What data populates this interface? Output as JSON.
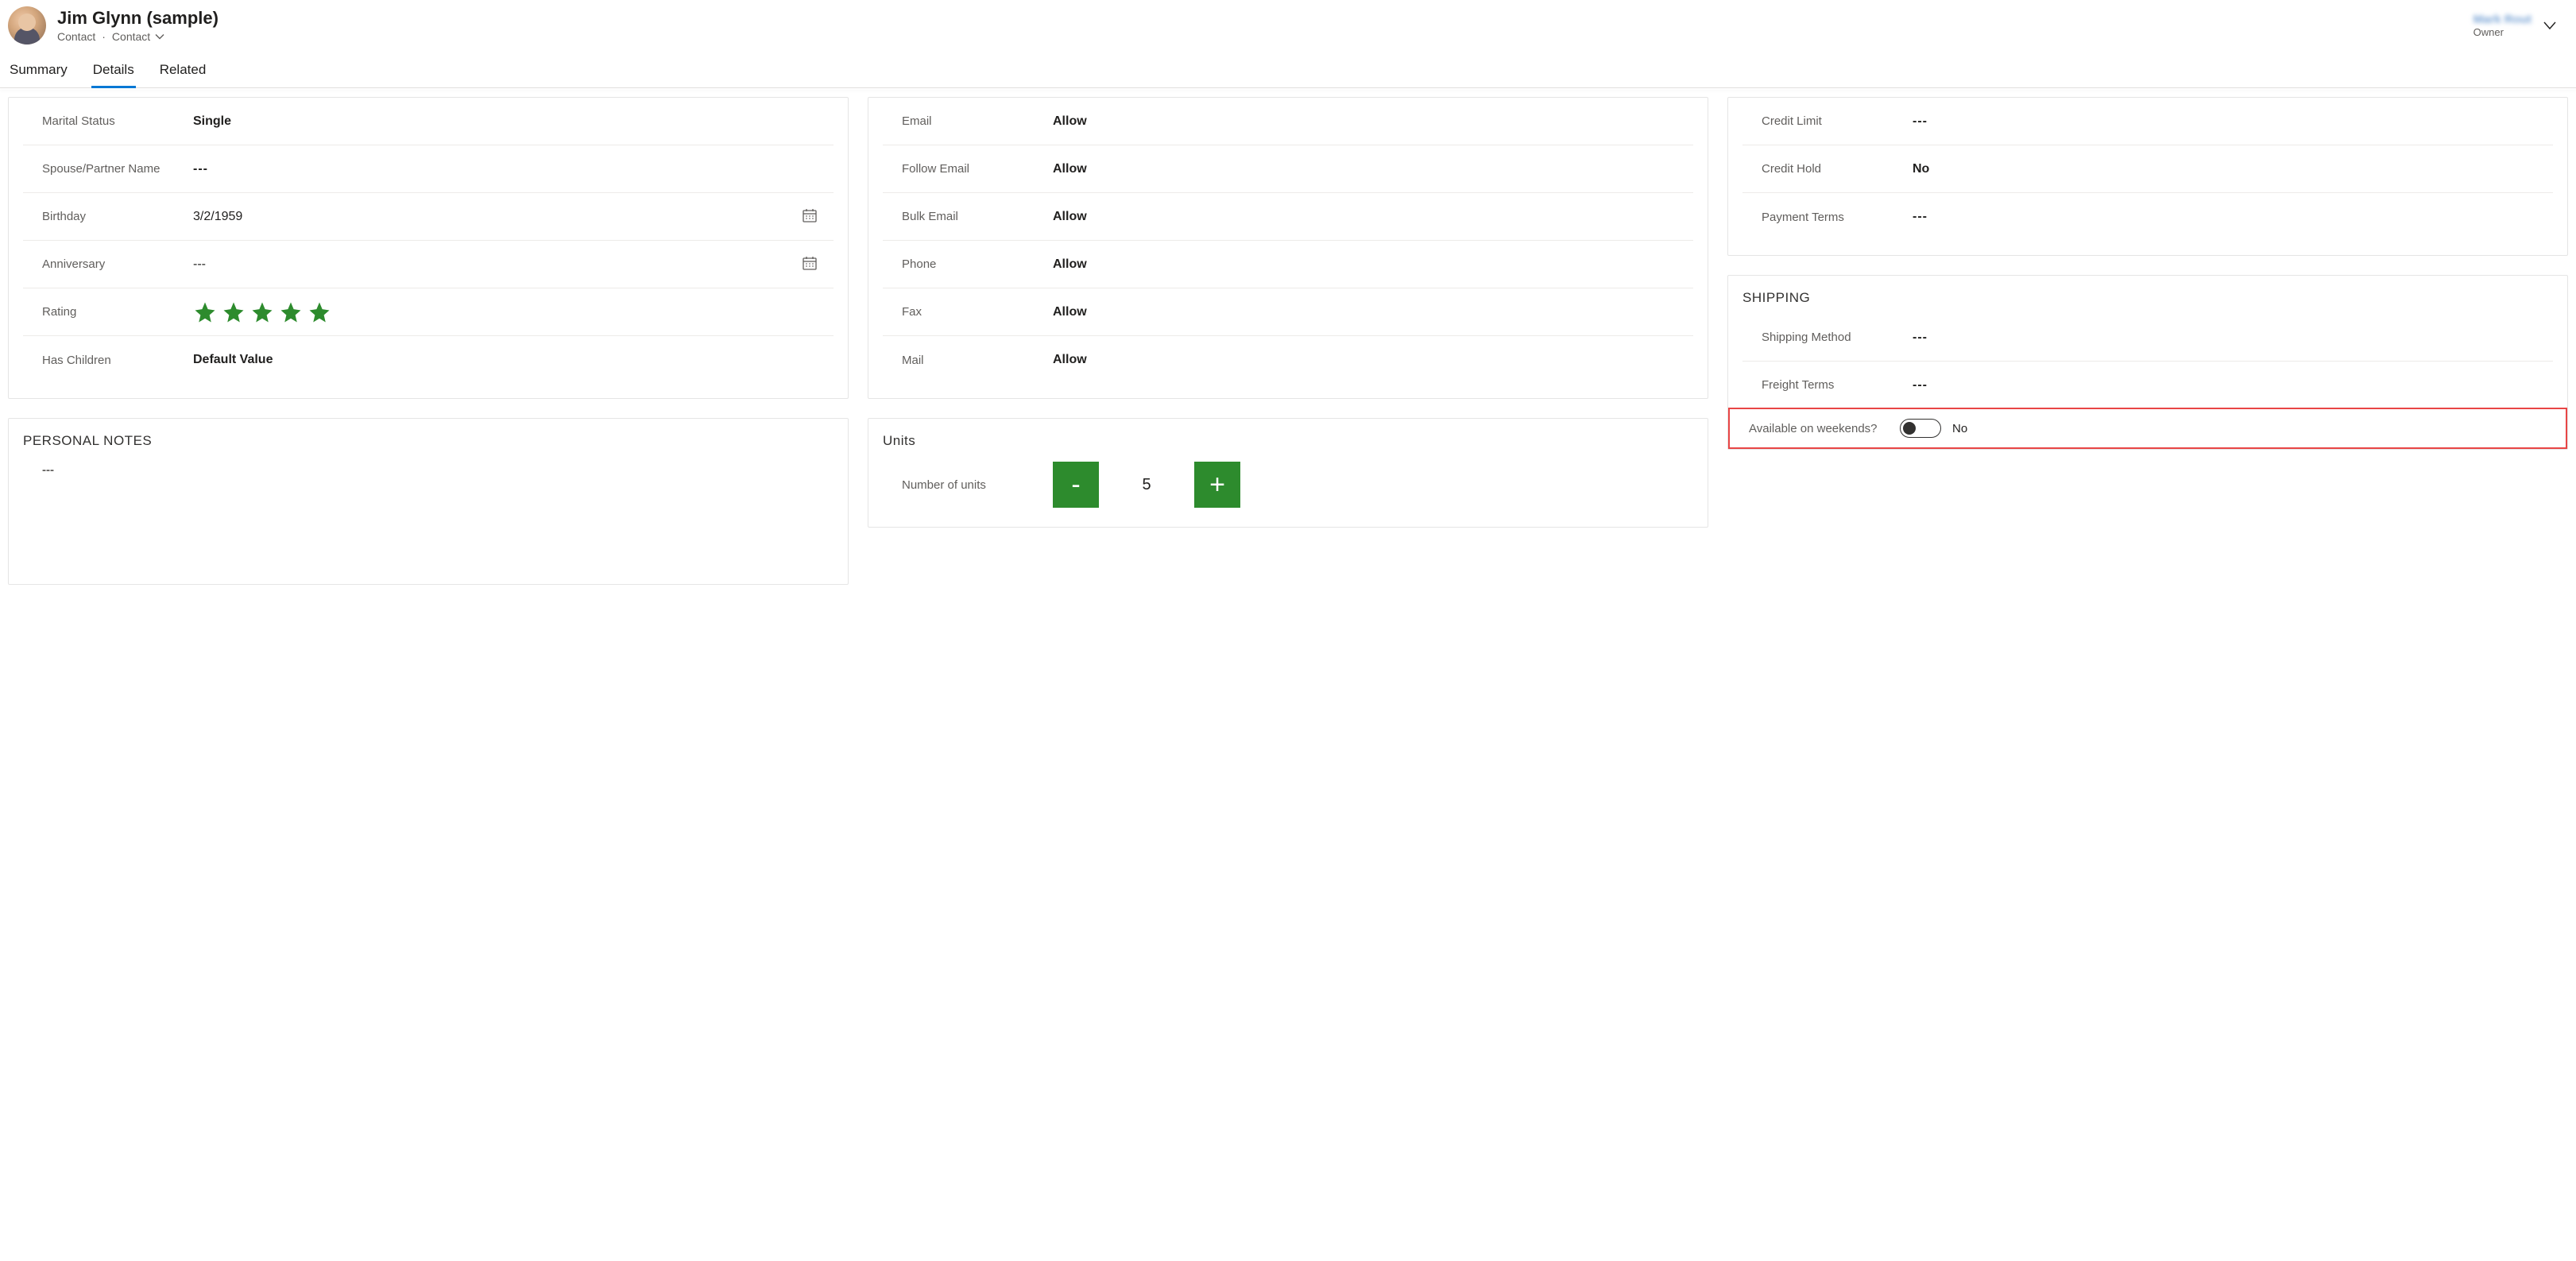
{
  "header": {
    "title": "Jim Glynn (sample)",
    "entity": "Contact",
    "form_selector": "Contact",
    "owner_name": "Mark Rout",
    "owner_label": "Owner"
  },
  "tabs": {
    "summary": "Summary",
    "details": "Details",
    "related": "Related"
  },
  "personal": {
    "marital_status_label": "Marital Status",
    "marital_status_value": "Single",
    "spouse_label": "Spouse/Partner Name",
    "spouse_value": "---",
    "birthday_label": "Birthday",
    "birthday_value": "3/2/1959",
    "anniversary_label": "Anniversary",
    "anniversary_value": "---",
    "rating_label": "Rating",
    "rating_value": 5,
    "has_children_label": "Has Children",
    "has_children_value": "Default Value"
  },
  "notes": {
    "title": "PERSONAL NOTES",
    "value": "---"
  },
  "comm": {
    "email_label": "Email",
    "email_value": "Allow",
    "follow_email_label": "Follow Email",
    "follow_email_value": "Allow",
    "bulk_email_label": "Bulk Email",
    "bulk_email_value": "Allow",
    "phone_label": "Phone",
    "phone_value": "Allow",
    "fax_label": "Fax",
    "fax_value": "Allow",
    "mail_label": "Mail",
    "mail_value": "Allow"
  },
  "units": {
    "title": "Units",
    "label": "Number of units",
    "value": "5",
    "minus": "-",
    "plus": "+"
  },
  "billing": {
    "credit_limit_label": "Credit Limit",
    "credit_limit_value": "---",
    "credit_hold_label": "Credit Hold",
    "credit_hold_value": "No",
    "payment_terms_label": "Payment Terms",
    "payment_terms_value": "---"
  },
  "shipping": {
    "title": "SHIPPING",
    "method_label": "Shipping Method",
    "method_value": "---",
    "freight_label": "Freight Terms",
    "freight_value": "---",
    "weekends_label": "Available on weekends?",
    "weekends_value": "No"
  }
}
